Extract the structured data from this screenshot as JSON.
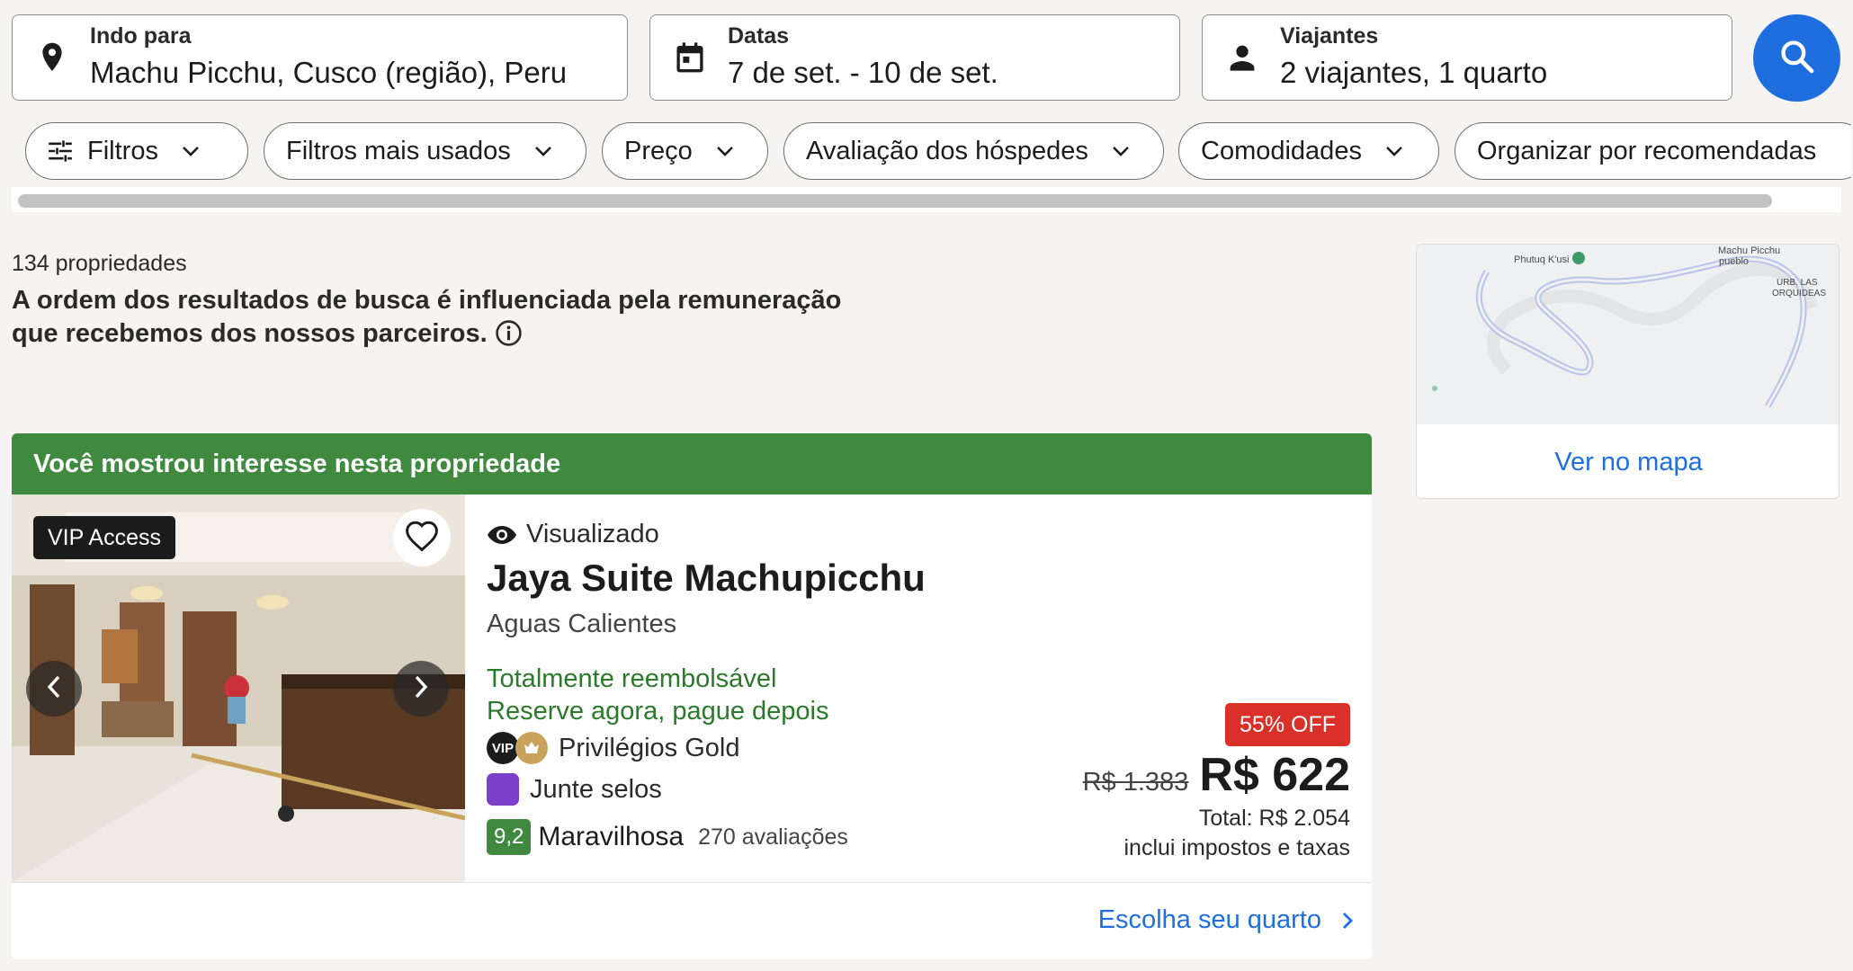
{
  "search": {
    "destination": {
      "label": "Indo para",
      "value": "Machu Picchu, Cusco (região), Peru",
      "icon": "location-pin-icon"
    },
    "dates": {
      "label": "Datas",
      "value": "7 de set. - 10 de set.",
      "icon": "calendar-icon"
    },
    "travelers": {
      "label": "Viajantes",
      "value": "2 viajantes, 1 quarto",
      "icon": "person-icon"
    },
    "search_button_icon": "search-icon"
  },
  "filters": [
    {
      "label": "Filtros"
    },
    {
      "label": "Filtros mais usados"
    },
    {
      "label": "Preço"
    },
    {
      "label": "Avaliação dos hóspedes"
    },
    {
      "label": "Comodidades"
    },
    {
      "label": "Organizar por recomendadas"
    }
  ],
  "results": {
    "count": "134 propriedades",
    "disclaimer": "A ordem dos resultados de busca é influenciada pela remuneração que recebemos dos nossos parceiros."
  },
  "map": {
    "link": "Ver no mapa",
    "labels": {
      "phutuq": "Phutuq K'usi",
      "machu": "Machu Picchu",
      "pueblo": "pueblo",
      "urb1": "URB. LAS",
      "urb2": "ORQUIDEAS"
    }
  },
  "property": {
    "interest_banner": "Você mostrou interesse nesta propriedade",
    "vip_badge": "VIP Access",
    "viewed": "Visualizado",
    "name": "Jaya Suite Machupicchu",
    "location": "Aguas Calientes",
    "refundable": "Totalmente reembolsável",
    "pay_later": "Reserve agora, pague depois",
    "vip_small": "VIP",
    "privileges": "Privilégios Gold",
    "stamps": "Junte selos",
    "score": "9,2",
    "rating_word": "Maravilhosa",
    "reviews": "270 avaliações",
    "discount": "55% OFF",
    "old_price": "R$ 1.383",
    "price": "R$ 622",
    "total": "Total: R$ 2.054",
    "taxes": "inclui impostos e taxas",
    "cta": "Escolha seu quarto"
  },
  "colors": {
    "accent_blue": "#1f6ee0",
    "green": "#3f8a3f",
    "discount_red": "#d9302a",
    "stamps_purple": "#7b3fc9",
    "gold": "#c9a25b"
  }
}
